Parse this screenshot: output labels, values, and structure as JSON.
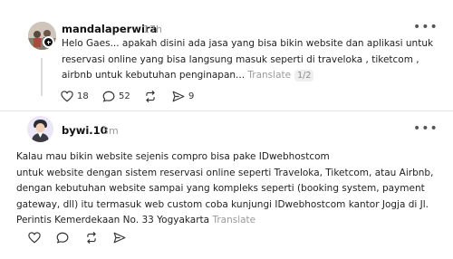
{
  "post1": {
    "username": "mandalaperwira",
    "time": "17h",
    "text": "Helo Gaes... apakah disini ada jasa yang bisa bikin website dan aplikasi untuk\nreservasi online yang bisa langsung masuk seperti di traveloka , tiketcom ,\nairbnb untuk kebutuhan penginapan...",
    "translate_label": "Translate",
    "page_indicator": "1/2",
    "likes": "18",
    "replies": "52",
    "shares": "9"
  },
  "post2": {
    "username": "bywi.10",
    "time": "3m",
    "text": "Kalau mau bikin website sejenis compro bisa pake IDwebhostcom\nuntuk website dengan sistem reservasi online seperti Traveloka, Tiketcom, atau Airbnb,\ndengan kebutuhan website sampai yang kompleks seperti (booking system, payment\ngateway, dll) itu termasuk web custom coba kunjungi IDwebhostcom kantor Jogja di Jl.\nPerintis Kemerdekaan No. 33 Yogyakarta",
    "translate_label": "Translate"
  },
  "icons": {
    "more": "more-horizontal-icon",
    "like": "heart-icon",
    "reply": "comment-icon",
    "repost": "repost-icon",
    "share": "share-icon"
  }
}
